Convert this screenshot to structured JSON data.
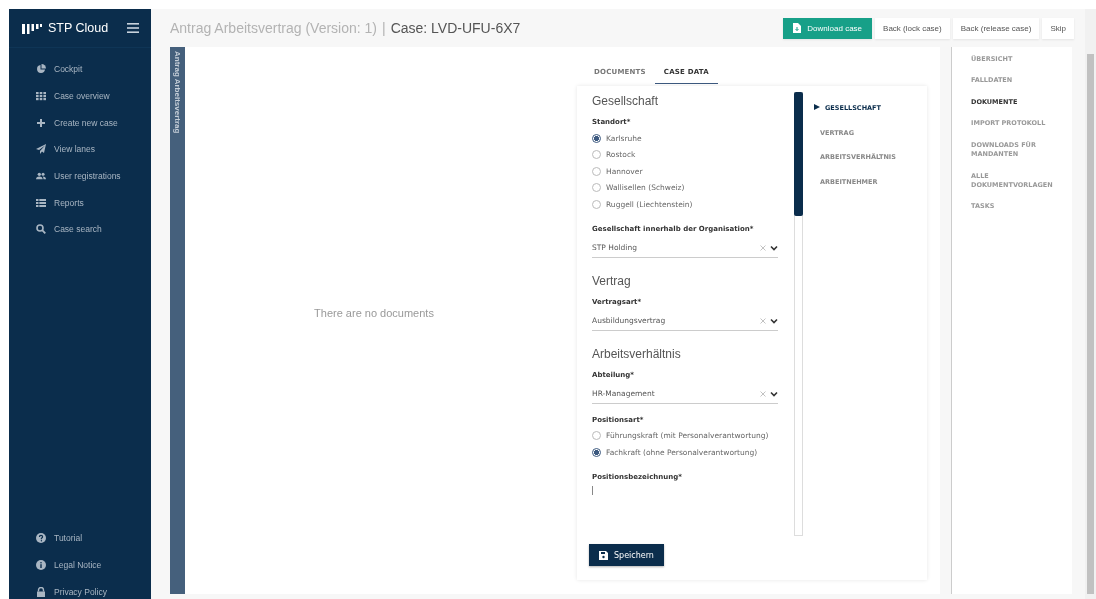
{
  "sidebar": {
    "brand": "STP Cloud",
    "items": [
      {
        "label": "Cockpit"
      },
      {
        "label": "Case overview"
      },
      {
        "label": "Create new case"
      },
      {
        "label": "View lanes"
      },
      {
        "label": "User registrations"
      },
      {
        "label": "Reports"
      },
      {
        "label": "Case search"
      }
    ],
    "footer_items": [
      {
        "label": "Tutorial"
      },
      {
        "label": "Legal Notice"
      },
      {
        "label": "Privacy Policy"
      }
    ]
  },
  "header": {
    "title": "Antrag Arbeitsvertrag (Version: 1)",
    "separator": "|",
    "case": "Case: LVD-UFU-6X7",
    "buttons": [
      {
        "label": "Download case",
        "kind": "primary"
      },
      {
        "label": "Back (lock case)",
        "kind": "plain"
      },
      {
        "label": "Back (release case)",
        "kind": "plain"
      },
      {
        "label": "Skip",
        "kind": "plain"
      }
    ]
  },
  "vertical_tab": "Antrag Arbeitsvertrag",
  "documents": {
    "empty_text": "There are no documents"
  },
  "tabs": [
    {
      "label": "DOCUMENTS",
      "selected": false
    },
    {
      "label": "CASE DATA",
      "selected": true
    }
  ],
  "form": {
    "sections": [
      {
        "title": "Gesellschaft",
        "fields": [
          {
            "kind": "radio",
            "label": "Standort*",
            "options": [
              {
                "label": "Karlsruhe",
                "selected": true
              },
              {
                "label": "Rostock",
                "selected": false
              },
              {
                "label": "Hannover",
                "selected": false
              },
              {
                "label": "Wallisellen (Schweiz)",
                "selected": false
              },
              {
                "label": "Ruggell (Liechtenstein)",
                "selected": false
              }
            ]
          },
          {
            "kind": "select",
            "label": "Gesellschaft innerhalb der Organisation*",
            "value": "STP Holding"
          }
        ]
      },
      {
        "title": "Vertrag",
        "fields": [
          {
            "kind": "select",
            "label": "Vertragsart*",
            "value": "Ausbildungsvertrag"
          }
        ]
      },
      {
        "title": "Arbeitsverhältnis",
        "fields": [
          {
            "kind": "select",
            "label": "Abteilung*",
            "value": "HR-Management"
          },
          {
            "kind": "radio",
            "label": "Positionsart*",
            "options": [
              {
                "label": "Führungskraft (mit Personalverantwortung)",
                "selected": false
              },
              {
                "label": "Fachkraft (ohne Personalverantwortung)",
                "selected": true
              }
            ]
          },
          {
            "kind": "text",
            "label": "Positionsbezeichnung*"
          }
        ]
      }
    ],
    "save_button": "Speichern"
  },
  "section_nav": [
    {
      "label": "GESELLSCHAFT",
      "selected": true
    },
    {
      "label": "VERTRAG",
      "selected": false
    },
    {
      "label": "ARBEITSVERHÄLTNIS",
      "selected": false
    },
    {
      "label": "ARBEITNEHMER",
      "selected": false
    }
  ],
  "right_nav": [
    {
      "label": "ÜBERSICHT",
      "selected": false
    },
    {
      "label": "FALLDATEN",
      "selected": false
    },
    {
      "label": "DOKUMENTE",
      "selected": true
    },
    {
      "label": "IMPORT PROTOKOLL",
      "selected": false
    },
    {
      "label": "DOWNLOADS FÜR MANDANTEN",
      "selected": false
    },
    {
      "label": "ALLE DOKUMENTVORLAGEN",
      "selected": false
    },
    {
      "label": "TASKS",
      "selected": false
    }
  ]
}
